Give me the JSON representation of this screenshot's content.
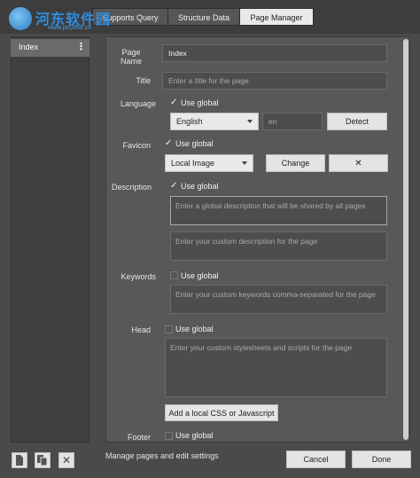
{
  "watermark": {
    "text": "河东软件园",
    "url": "www.pc0359.cn"
  },
  "tabs": [
    {
      "label": "Supports Query",
      "active": false
    },
    {
      "label": "Structure Data",
      "active": false
    },
    {
      "label": "Page Manager",
      "active": true
    }
  ],
  "pages": [
    {
      "label": "Index",
      "menu": "⋮"
    }
  ],
  "form": {
    "page_name_label": "Page\nName",
    "page_name_value": "Index",
    "title_label": "Title",
    "title_placeholder": "Enter a title for the page",
    "language_label": "Language",
    "language_use_global": "Use global",
    "language_selected": "English",
    "language_code": "en",
    "detect_button": "Detect",
    "favicon_label": "Favicon",
    "favicon_use_global": "Use global",
    "favicon_source": "Local Image",
    "change_button": "Change",
    "remove_button": "✕",
    "description_label": "Description",
    "description_use_global": "Use global",
    "description_global_placeholder": "Enter a global description that will be shared by all pages",
    "description_custom_placeholder": "Enter your custom description for the page",
    "keywords_label": "Keywords",
    "keywords_use_global": "Use global",
    "keywords_placeholder": "Enter your custom keywords comma-separated for the page",
    "head_label": "Head",
    "head_use_global": "Use global",
    "head_placeholder": "Enter your custom stylesheets and scripts for the page",
    "add_css_js_button": "Add a local CSS or Javascript",
    "footer_label": "Footer",
    "footer_use_global": "Use global"
  },
  "footer": {
    "status": "Manage pages and edit settings",
    "cancel": "Cancel",
    "done": "Done"
  }
}
